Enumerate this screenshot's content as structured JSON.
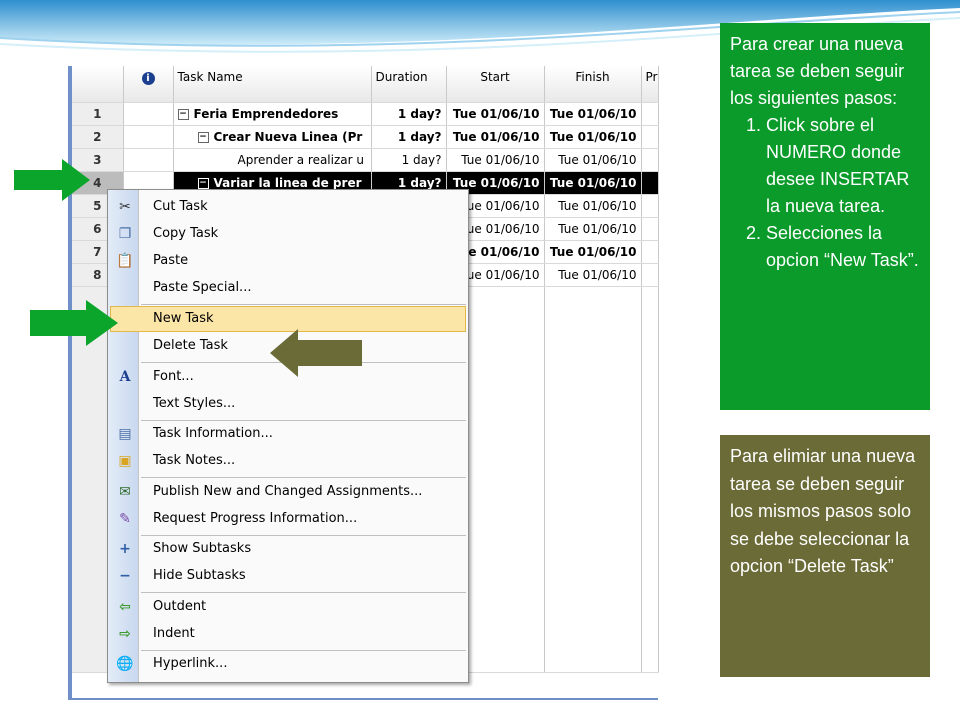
{
  "grid": {
    "headers": {
      "task_name": "Task Name",
      "duration": "Duration",
      "start": "Start",
      "finish": "Finish",
      "pr": "Pr"
    },
    "rows": [
      {
        "num": "1",
        "name": "Feria Emprendedores",
        "duration": "1 day?",
        "start": "Tue 01/06/10",
        "finish": "Tue 01/06/10"
      },
      {
        "num": "2",
        "name": "Crear Nueva Linea (Pr",
        "duration": "1 day?",
        "start": "Tue 01/06/10",
        "finish": "Tue 01/06/10"
      },
      {
        "num": "3",
        "name": "Aprender a realizar u",
        "duration": "1 day?",
        "start": "Tue 01/06/10",
        "finish": "Tue 01/06/10"
      },
      {
        "num": "4",
        "name": "Variar la linea de prer",
        "duration": "1 day?",
        "start": "Tue 01/06/10",
        "finish": "Tue 01/06/10"
      },
      {
        "num": "5",
        "name": "",
        "duration": "",
        "start": "ue 01/06/10",
        "finish": "Tue 01/06/10"
      },
      {
        "num": "6",
        "name": "",
        "duration": "",
        "start": "ue 01/06/10",
        "finish": "Tue 01/06/10"
      },
      {
        "num": "7",
        "name": "",
        "duration": "",
        "start": "e 01/06/10",
        "finish": "Tue 01/06/10"
      },
      {
        "num": "8",
        "name": "",
        "duration": "",
        "start": "ue 01/06/10",
        "finish": "Tue 01/06/10"
      }
    ]
  },
  "menu": {
    "items": [
      {
        "label": "Cut Task",
        "icon": "scissors-icon"
      },
      {
        "label": "Copy Task",
        "icon": "copy-icon"
      },
      {
        "label": "Paste",
        "icon": "paste-icon"
      },
      {
        "label": "Paste Special...",
        "icon": ""
      },
      {
        "label": "New Task",
        "icon": ""
      },
      {
        "label": "Delete Task",
        "icon": ""
      },
      {
        "label": "Font...",
        "icon": "font-icon"
      },
      {
        "label": "Text Styles...",
        "icon": ""
      },
      {
        "label": "Task Information...",
        "icon": "task-info-icon"
      },
      {
        "label": "Task Notes...",
        "icon": "note-icon"
      },
      {
        "label": "Publish New and Changed Assignments...",
        "icon": "publish-icon"
      },
      {
        "label": "Request Progress Information...",
        "icon": "request-icon"
      },
      {
        "label": "Show Subtasks",
        "icon": "plus-icon"
      },
      {
        "label": "Hide Subtasks",
        "icon": "minus-icon"
      },
      {
        "label": "Outdent",
        "icon": "outdent-arrow-icon"
      },
      {
        "label": "Indent",
        "icon": "indent-arrow-icon"
      },
      {
        "label": "Hyperlink...",
        "icon": "hyperlink-icon"
      }
    ]
  },
  "instructions": {
    "intro": "Para crear una nueva tarea se deben seguir los siguientes pasos:",
    "step1": "Click sobre el NUMERO donde desee INSERTAR la nueva tarea.",
    "step2": "Selecciones la opcion “New Task”.",
    "delete_note": "Para elimiar una nueva tarea se deben seguir los mismos pasos solo se debe seleccionar la opcion “Delete Task”"
  },
  "colors": {
    "green_box": "#0b9b2b",
    "olive_box": "#6b6b37",
    "green_arrow": "#0aa52a",
    "olive_arrow": "#6b6b37",
    "highlight": "#fbe6a8"
  }
}
